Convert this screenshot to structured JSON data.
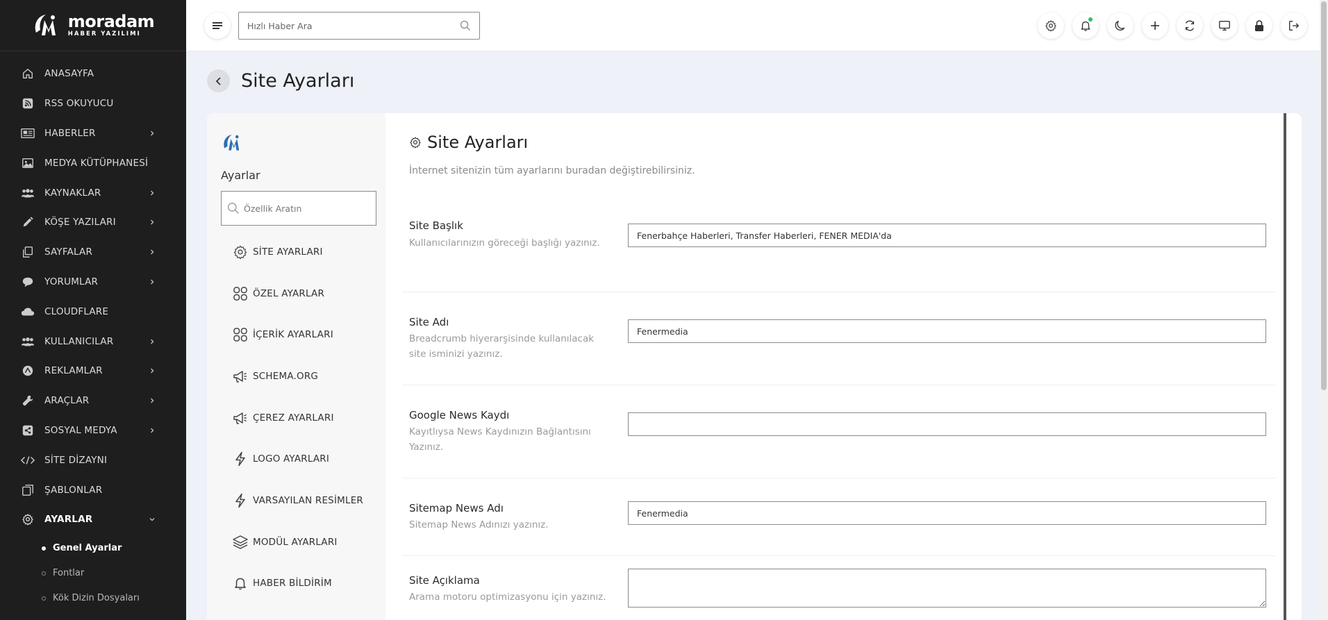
{
  "brand": {
    "name": "moradam",
    "sub": "HABER YAZILIMI"
  },
  "sidebar": {
    "items": [
      {
        "label": "ANASAYFA",
        "icon": "home-icon",
        "chevron": false
      },
      {
        "label": "RSS OKUYUCU",
        "icon": "rss-icon",
        "chevron": false
      },
      {
        "label": "HABERLER",
        "icon": "newspaper-icon",
        "chevron": true
      },
      {
        "label": "MEDYA KÜTÜPHANESİ",
        "icon": "image-icon",
        "chevron": false
      },
      {
        "label": "KAYNAKLAR",
        "icon": "users-icon",
        "chevron": true
      },
      {
        "label": "KÖŞE YAZILARI",
        "icon": "pen-icon",
        "chevron": true
      },
      {
        "label": "SAYFALAR",
        "icon": "pages-icon",
        "chevron": true
      },
      {
        "label": "YORUMLAR",
        "icon": "comment-icon",
        "chevron": true
      },
      {
        "label": "CLOUDFLARE",
        "icon": "cloud-icon",
        "chevron": false
      },
      {
        "label": "KULLANICILAR",
        "icon": "users-icon",
        "chevron": true
      },
      {
        "label": "REKLAMLAR",
        "icon": "ad-icon",
        "chevron": true
      },
      {
        "label": "ARAÇLAR",
        "icon": "wrench-icon",
        "chevron": true
      },
      {
        "label": "SOSYAL MEDYA",
        "icon": "share-icon",
        "chevron": true
      },
      {
        "label": "SİTE DİZAYNI",
        "icon": "code-icon",
        "chevron": false
      },
      {
        "label": "ŞABLONLAR",
        "icon": "template-icon",
        "chevron": false
      },
      {
        "label": "AYARLAR",
        "icon": "gear-icon",
        "chevron": true,
        "active": true
      }
    ],
    "sub_items": [
      {
        "label": "Genel Ayarlar",
        "active": true
      },
      {
        "label": "Fontlar",
        "active": false
      },
      {
        "label": "Kök Dizin Dosyaları",
        "active": false
      }
    ]
  },
  "topbar": {
    "search_placeholder": "Hızlı Haber Ara",
    "icons": [
      "gear-icon",
      "bell-icon",
      "moon-icon",
      "plus-icon",
      "refresh-icon",
      "monitor-icon",
      "lock-icon",
      "logout-icon"
    ]
  },
  "page": {
    "title": "Site Ayarları"
  },
  "settings_nav": {
    "heading": "Ayarlar",
    "search_placeholder": "Özellik Aratın",
    "items": [
      {
        "label": "SİTE AYARLARI",
        "icon": "gear-icon"
      },
      {
        "label": "ÖZEL AYARLAR",
        "icon": "grid-icon"
      },
      {
        "label": "İÇERİK AYARLARI",
        "icon": "grid-icon"
      },
      {
        "label": "SCHEMA.ORG",
        "icon": "megaphone-icon"
      },
      {
        "label": "ÇEREZ AYARLARI",
        "icon": "megaphone-icon"
      },
      {
        "label": "LOGO AYARLARI",
        "icon": "bolt-icon"
      },
      {
        "label": "VARSAYILAN RESİMLER",
        "icon": "bolt-icon"
      },
      {
        "label": "MODÜL AYARLARI",
        "icon": "layers-icon"
      },
      {
        "label": "HABER BİLDİRİM",
        "icon": "bell-icon"
      }
    ]
  },
  "content": {
    "title": "Site Ayarları",
    "description": "İnternet sitenizin tüm ayarlarını buradan değiştirebilirsiniz.",
    "fields": [
      {
        "label": "Site Başlık",
        "hint": "Kullanıcılarınızın göreceği başlığı yazınız.",
        "value": "Fenerbahçe Haberleri, Transfer Haberleri, FENER MEDIA'da"
      },
      {
        "label": "Site Adı",
        "hint": "Breadcrumb hiyerarşisinde kullanılacak site isminizi yazınız.",
        "value": "Fenermedia"
      },
      {
        "label": "Google News Kaydı",
        "hint": "Kayıtlıysa News Kaydınızın Bağlantısını Yazınız.",
        "value": ""
      },
      {
        "label": "Sitemap News Adı",
        "hint": "Sitemap News Adınızı yazınız.",
        "value": "Fenermedia"
      },
      {
        "label": "Site Açıklama",
        "hint": "Arama motoru optimizasyonu için yazınız.",
        "value": ""
      }
    ]
  }
}
